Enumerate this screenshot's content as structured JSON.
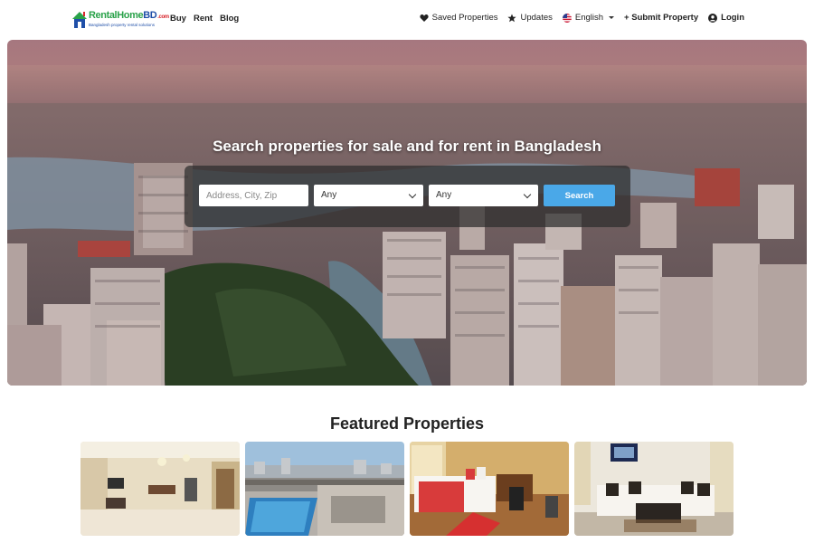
{
  "header": {
    "logo": {
      "name_part1": "RentalHome",
      "name_part2": "BD",
      "tld": ".com",
      "tagline": "Bangladesh property rental solutions"
    },
    "nav_left": [
      "Buy",
      "Rent",
      "Blog"
    ],
    "saved_properties": "Saved Properties",
    "updates": "Updates",
    "language": "English",
    "submit_property": "+ Submit Property",
    "login": "Login"
  },
  "hero": {
    "title": "Search properties for sale and for rent in Bangladesh",
    "search": {
      "placeholder": "Address, City, Zip",
      "value": "",
      "select1": "Any",
      "select2": "Any",
      "button": "Search"
    }
  },
  "featured": {
    "title": "Featured Properties",
    "cards": [
      "living-room",
      "rooftop-pool",
      "bedroom",
      "lounge"
    ]
  },
  "colors": {
    "accent": "#4aa8e8",
    "logo_green": "#2aa24a",
    "logo_blue": "#1f4fa8",
    "logo_red": "#d8262d"
  }
}
